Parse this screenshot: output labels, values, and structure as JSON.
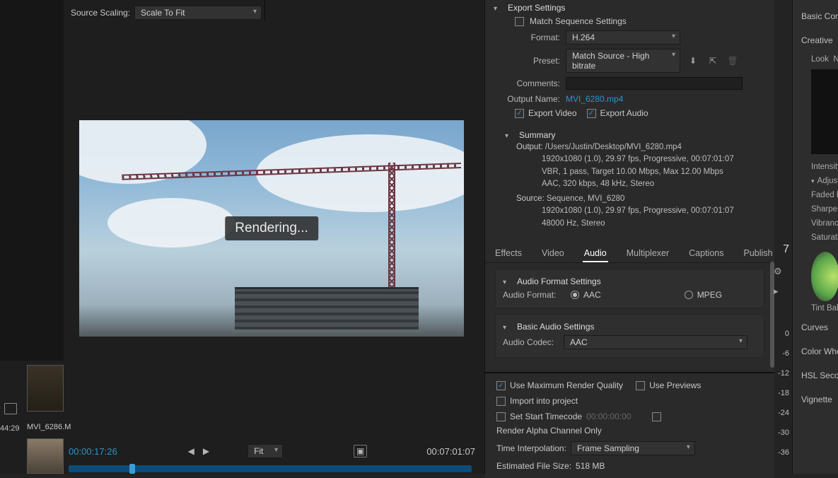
{
  "left": {
    "source_scaling_label": "Source Scaling:",
    "source_scaling_value": "Scale To Fit",
    "rendering_text": "Rendering...",
    "thumb_label": "MVI_6286.M",
    "time_left": "44:29",
    "tc_current": "00:00:17:26",
    "tc_duration": "00:07:01:07",
    "fit_label": "Fit"
  },
  "export": {
    "title": "Export Settings",
    "match_seq": "Match Sequence Settings",
    "format_label": "Format:",
    "format_value": "H.264",
    "preset_label": "Preset:",
    "preset_value": "Match Source - High bitrate",
    "comments_label": "Comments:",
    "output_name_label": "Output Name:",
    "output_name_value": "MVI_6280.mp4",
    "export_video": "Export Video",
    "export_audio": "Export Audio",
    "summary_title": "Summary",
    "summary_output_label": "Output:",
    "summary_output_path": "/Users/Justin/Desktop/MVI_6280.mp4",
    "summary_output_line1": "1920x1080 (1.0), 29.97 fps, Progressive, 00:07:01:07",
    "summary_output_line2": "VBR, 1 pass, Target 10.00 Mbps, Max 12.00 Mbps",
    "summary_output_line3": "AAC, 320 kbps, 48 kHz, Stereo",
    "summary_source_label": "Source:",
    "summary_source_line0": "Sequence, MVI_6280",
    "summary_source_line1": "1920x1080 (1.0), 29.97 fps, Progressive, 00:07:01:07",
    "summary_source_line2": "48000 Hz, Stereo",
    "tabs": {
      "effects": "Effects",
      "video": "Video",
      "audio": "Audio",
      "multiplexer": "Multiplexer",
      "captions": "Captions",
      "publish": "Publish"
    },
    "audio_fmt_title": "Audio Format Settings",
    "audio_format_label": "Audio Format:",
    "audio_format_aac": "AAC",
    "audio_format_mpeg": "MPEG",
    "basic_audio_title": "Basic Audio Settings",
    "audio_codec_label": "Audio Codec:",
    "audio_codec_value": "AAC"
  },
  "bottom": {
    "max_render": "Use Maximum Render Quality",
    "use_previews": "Use Previews",
    "import_project": "Import into project",
    "set_start_tc": "Set Start Timecode",
    "start_tc_value": "00:00:00:00",
    "render_alpha": "Render Alpha Channel Only",
    "time_interp_label": "Time Interpolation:",
    "time_interp_value": "Frame Sampling",
    "est_size_label": "Estimated File Size:",
    "est_size_value": "518 MB"
  },
  "lumetri": {
    "basic": "Basic Correc",
    "creative": "Creative",
    "look": "Look",
    "lookval": "N",
    "intensity": "Intensity",
    "adjustments": "Adjustme",
    "faded": "Faded Fi",
    "sharpen": "Sharpen",
    "vibrance": "Vibrance",
    "saturation": "Saturatio",
    "tint_balance": "Tint Bala",
    "curves": "Curves",
    "color_wheels": "Color Whee",
    "hsl": "HSL Second",
    "vignette": "Vignette"
  },
  "side_col": {
    "n7": "7",
    "nums": [
      "0",
      "-6",
      "-12",
      "-18",
      "-24",
      "-30",
      "-36"
    ]
  }
}
